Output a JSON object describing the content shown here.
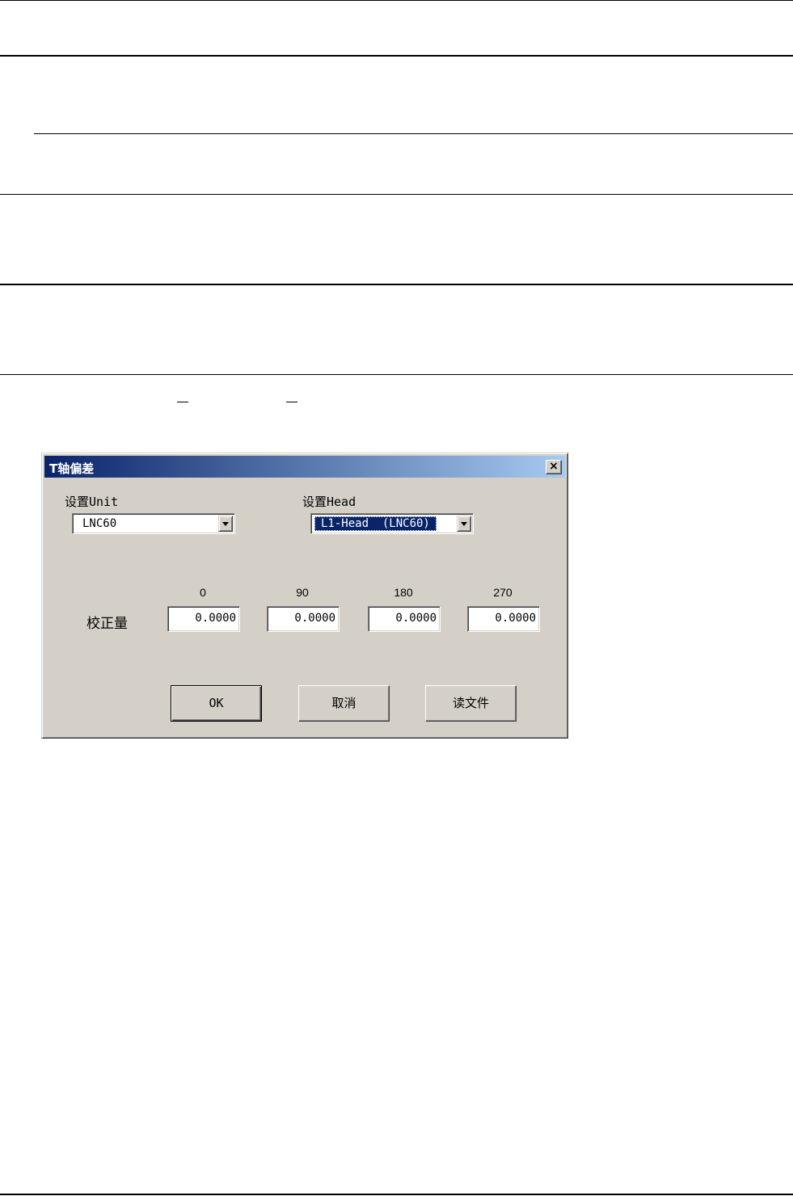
{
  "dialog": {
    "title": "T轴偏差",
    "close_glyph": "×",
    "unit_label": "设置Unit",
    "unit_value": "LNC60",
    "head_label": "设置Head",
    "head_value": "L1-Head  (LNC60)",
    "columns": [
      "0",
      "90",
      "180",
      "270"
    ],
    "row_label": "校正量",
    "values": [
      "0.0000",
      "0.0000",
      "0.0000",
      "0.0000"
    ],
    "buttons": {
      "ok": "OK",
      "cancel": "取消",
      "read_file": "读文件"
    }
  }
}
